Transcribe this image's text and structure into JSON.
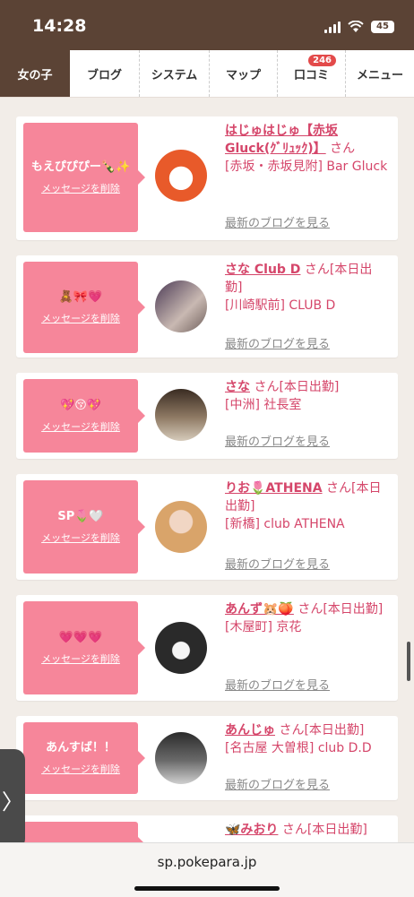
{
  "status": {
    "time": "14:28",
    "battery": "45"
  },
  "tabs": [
    {
      "label": "女の子"
    },
    {
      "label": "ブログ"
    },
    {
      "label": "システム"
    },
    {
      "label": "マップ"
    },
    {
      "label": "口コミ",
      "badge": "246"
    },
    {
      "label": "メニュー"
    }
  ],
  "cards": [
    {
      "message": "もえぴぴぴー🍾✨",
      "delete": "メッセージを削除",
      "name": "はじゅはじゅ【赤坂Gluck(ｸﾞﾘｭｯｸ)】",
      "san": "さん",
      "shop": "[赤坂・赤坂見附] Bar Gluck",
      "blog": "最新のブログを見る"
    },
    {
      "message": "🧸🎀💗",
      "delete": "メッセージを削除",
      "name": "さな Club D",
      "san": "さん[本日出勤]",
      "shop": "[川崎駅前] CLUB D",
      "blog": "最新のブログを見る"
    },
    {
      "message": "💖😚💖",
      "delete": "メッセージを削除",
      "name": "さな",
      "san": "さん[本日出勤]",
      "shop": "[中洲] 社長室",
      "blog": "最新のブログを見る"
    },
    {
      "message": "SP🌷🤍",
      "delete": "メッセージを削除",
      "name": "りお🌷ATHENA",
      "san": "さん[本日出勤]",
      "shop": "[新橋] club ATHENA",
      "blog": "最新のブログを見る"
    },
    {
      "message": "💗💗💗",
      "delete": "メッセージを削除",
      "name": "あんず🐹🍑",
      "san": "さん[本日出勤]",
      "shop": "[木屋町] 京花",
      "blog": "最新のブログを見る"
    },
    {
      "message": "あんすば！！",
      "delete": "メッセージを削除",
      "name": "あんじゅ",
      "san": "さん[本日出勤]",
      "shop": "[名古屋 大曽根] club D.D",
      "blog": "最新のブログを見る"
    },
    {
      "message": "",
      "delete": "",
      "name": "🦋みおり",
      "san": "さん[本日出勤]",
      "shop": "",
      "blog": ""
    }
  ],
  "side_tab": "〉",
  "url": "sp.pokepara.jp"
}
